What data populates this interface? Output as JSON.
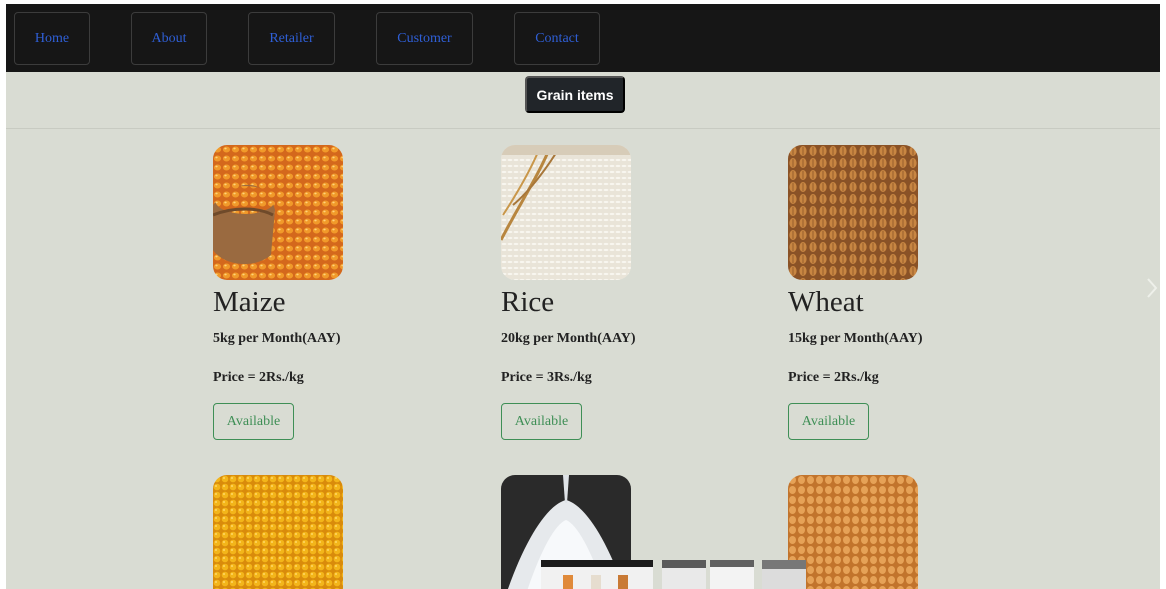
{
  "nav": {
    "items": [
      {
        "label": "Home"
      },
      {
        "label": "About"
      },
      {
        "label": "Retailer"
      },
      {
        "label": "Customer"
      },
      {
        "label": "Contact"
      }
    ]
  },
  "section": {
    "title": "Grain items"
  },
  "products": [
    {
      "name": "Maize",
      "quantity": "5kg per Month(AAY)",
      "price": "Price = 2Rs./kg",
      "status": "Available",
      "image": "maize-image"
    },
    {
      "name": "Rice",
      "quantity": "20kg per Month(AAY)",
      "price": "Price = 3Rs./kg",
      "status": "Available",
      "image": "rice-image"
    },
    {
      "name": "Wheat",
      "quantity": "15kg per Month(AAY)",
      "price": "Price = 2Rs./kg",
      "status": "Available",
      "image": "wheat-image"
    },
    {
      "image": "yellow-lentil-image"
    },
    {
      "image": "sugar-image"
    },
    {
      "image": "grain-image"
    }
  ],
  "icons": {
    "next": "chevron-right-icon"
  },
  "colors": {
    "navbar": "#161616",
    "nav_link": "#2f5fd6",
    "page_bg": "#d9dcd3",
    "available": "#3f8f56",
    "section_button": "#212529"
  }
}
